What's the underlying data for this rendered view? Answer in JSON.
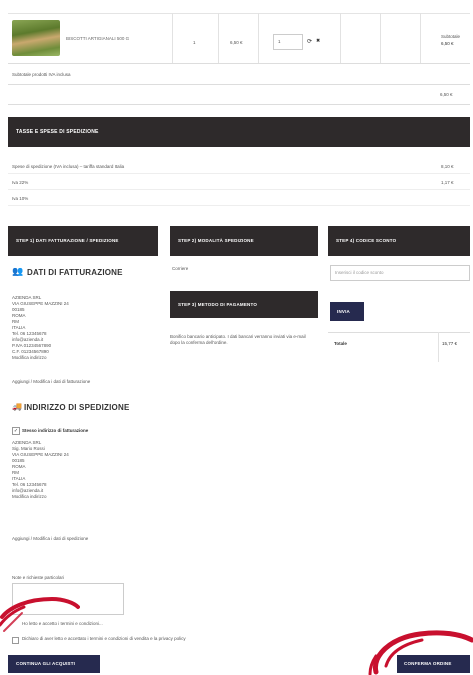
{
  "cart": {
    "product_name": "BISCOTTI ARTIGIANALI 500 G",
    "qty": "1",
    "unit_price": "6,50 €",
    "qty_input": "1",
    "row_total_label": "Subtotale",
    "row_total": "6,50 €",
    "subtotal_label": "Subtotale prodotti IVA inclusa",
    "subtotal_value": "6,50 €"
  },
  "shipping_section": {
    "bar_title": "TASSE E SPESE DI SPEDIZIONE",
    "lines": [
      {
        "label": "Spese di spedizione (IVA inclusa) – tariffa standard Italia",
        "value": "8,10 €"
      },
      {
        "label": "Iva 22%",
        "value": "1,17 €"
      },
      {
        "label": "Iva 10%",
        "value": ""
      }
    ]
  },
  "steps": {
    "billing_title": "STEP 1) DATI FATTURAZIONE / SPEDIZIONE",
    "shipping_method_title": "STEP 2) MODALITÀ SPEDIZIONE",
    "coupon_title": "STEP 4) CODICE SCONTO",
    "payment_title": "STEP 3) METODO DI PAGAMENTO"
  },
  "billing": {
    "heading": "DATI DI FATTURAZIONE",
    "lines": [
      "AZIENDA SRL",
      "VIA GIUSEPPE MAZZINI 24",
      "00185",
      "ROMA",
      "RM",
      "ITALIA",
      "Tel. 06 12345678",
      "info@azienda.it",
      "P.IVA 01234567890",
      "C.F. 01234567890",
      "Modifica indirizzo"
    ],
    "edit_link": "Aggiungi / Modifica i dati di fatturazione"
  },
  "shipping_method": {
    "value": "Corriere"
  },
  "coupon": {
    "placeholder": "Inserisci il codice sconto",
    "button": "INVIA",
    "total_label": "Totale",
    "total_value": "15,77 €"
  },
  "payment": {
    "note": "Bonifico bancario anticipato. I dati bancari verranno inviati via e-mail dopo la conferma dell'ordine."
  },
  "shipping_address": {
    "heading": "INDIRIZZO DI SPEDIZIONE",
    "checkbox_label": "Stesso indirizzo di fatturazione",
    "lines": [
      "AZIENDA SRL",
      "Sig. Mario Rossi",
      "VIA GIUSEPPE MAZZINI 24",
      "00185",
      "ROMA",
      "RM",
      "ITALIA",
      "Tel. 06 12345678",
      "info@azienda.it",
      "Modifica indirizzo"
    ],
    "edit_link": "Aggiungi / Modifica i dati di spedizione"
  },
  "notes": {
    "label": "Note e richieste particolari",
    "footer_text": "Ho letto e accetto i termini e condizioni..."
  },
  "privacy": {
    "label": "Dichiaro di aver letto e accettato i termini e condizioni di vendita e la privacy policy"
  },
  "buttons": {
    "continue": "CONTINUA GLI ACQUISTI",
    "confirm": "CONFERMA ORDINE"
  },
  "colors": {
    "dark_bar": "#2e2a2b",
    "navy_button": "#262a4f",
    "red_annotation": "#c8102e"
  }
}
